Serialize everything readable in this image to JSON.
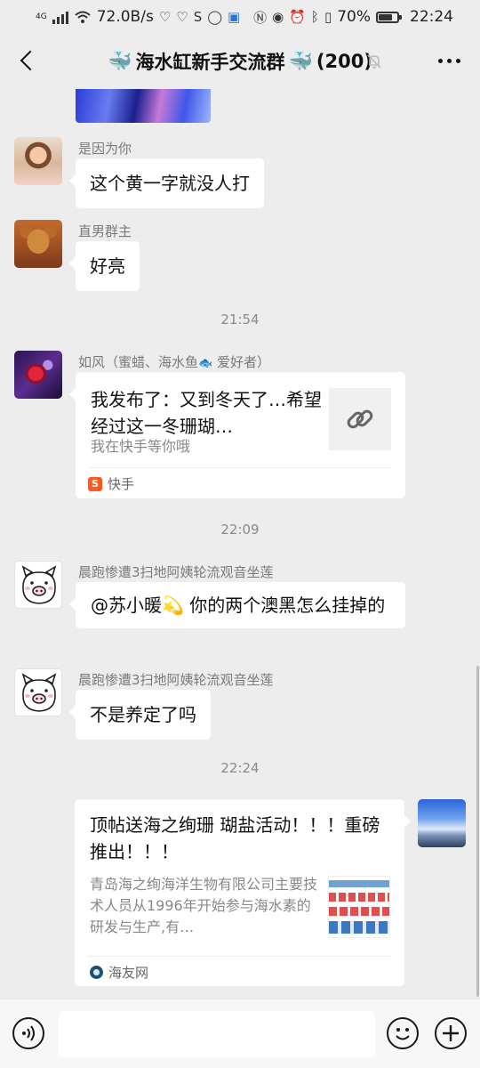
{
  "status_bar": {
    "network_type": "4G",
    "speed": "72.0B/s",
    "battery": "70%",
    "battery_level": 0.7,
    "time": "22:24"
  },
  "nav": {
    "title": "海水缸新手交流群",
    "member_count": "(200)",
    "title_emoji": "🐳"
  },
  "messages": {
    "m1": {
      "sender": "是因为你",
      "text": "这个黄一字就没人打"
    },
    "m2": {
      "sender": "直男群主",
      "text": "好亮"
    },
    "time1": "21:54",
    "m3": {
      "sender_prefix": "如风（蜜蜡、海水鱼",
      "sender_emoji": "🐟",
      "sender_suffix": " 爱好者）",
      "card_title": "我发布了：又到冬天了…希望经过这一冬珊瑚…",
      "card_desc": "我在快手等你哦",
      "source": "快手",
      "source_logo": "S"
    },
    "time2": "22:09",
    "m4": {
      "sender": "晨跑惨遭3扫地阿姨轮流观音坐莲",
      "mention": "@苏小暖",
      "mention_emoji": "💫",
      "text": " 你的两个澳黑怎么挂掉的"
    },
    "m5": {
      "sender": "晨跑惨遭3扫地阿姨轮流观音坐莲",
      "text": "不是养定了吗"
    },
    "time3": "22:24",
    "m6": {
      "card_title": "顶帖送海之绚珊 瑚盐活动！！！重磅推出！！！",
      "card_desc": "青岛海之绚海洋生物有限公司主要技术人员从1996年开始参与海水素的研发与生产,有…",
      "source": "海友网"
    }
  },
  "icons": {
    "back": "chevron-left-icon",
    "mute": "bell-mute-icon",
    "more": "more-dots-icon",
    "link": "link-icon",
    "voice": "voice-icon",
    "emoji": "emoji-icon",
    "plus": "plus-icon"
  },
  "colors": {
    "background": "#ededed",
    "bubble": "#ffffff",
    "kuaishou": "#ff5a1f"
  }
}
